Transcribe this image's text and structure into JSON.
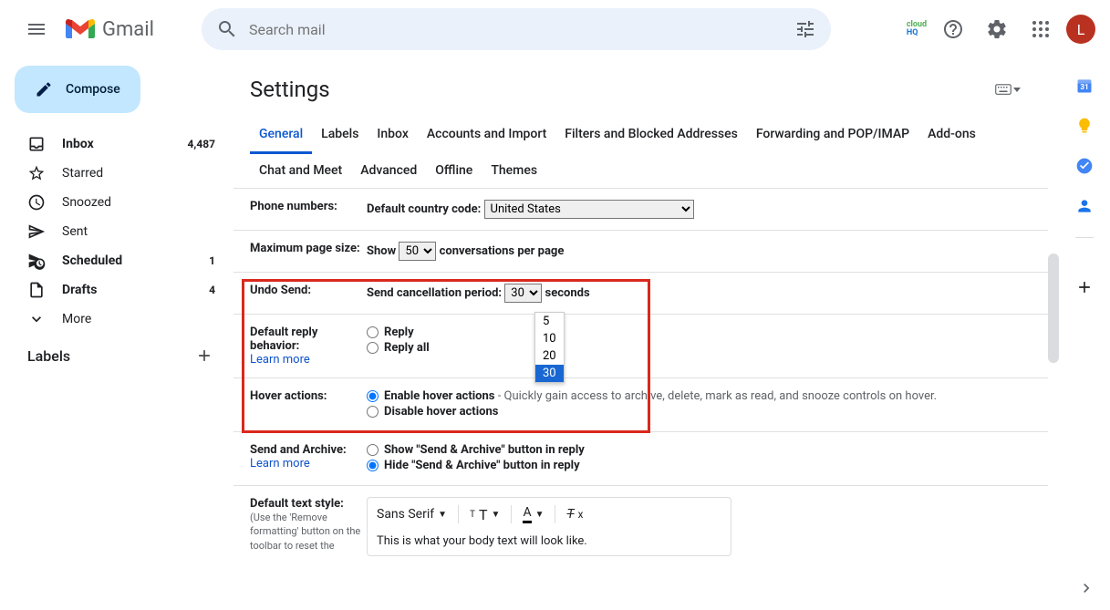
{
  "header": {
    "app_name": "Gmail",
    "search_placeholder": "Search mail",
    "avatar_letter": "L",
    "cloudhq_top": "cloud",
    "cloudhq_bottom": "HQ"
  },
  "sidebar": {
    "compose": "Compose",
    "items": [
      {
        "label": "Inbox",
        "count": "4,487",
        "bold": true
      },
      {
        "label": "Starred",
        "count": "",
        "bold": false
      },
      {
        "label": "Snoozed",
        "count": "",
        "bold": false
      },
      {
        "label": "Sent",
        "count": "",
        "bold": false
      },
      {
        "label": "Scheduled",
        "count": "1",
        "bold": true
      },
      {
        "label": "Drafts",
        "count": "4",
        "bold": true
      },
      {
        "label": "More",
        "count": "",
        "bold": false
      }
    ],
    "labels_header": "Labels"
  },
  "settings": {
    "title": "Settings",
    "tabs": [
      "General",
      "Labels",
      "Inbox",
      "Accounts and Import",
      "Filters and Blocked Addresses",
      "Forwarding and POP/IMAP",
      "Add-ons",
      "Chat and Meet",
      "Advanced",
      "Offline",
      "Themes"
    ],
    "active_tab": 0,
    "phone": {
      "label": "Phone numbers:",
      "desc": "Default country code:",
      "value": "United States"
    },
    "page_size": {
      "label": "Maximum page size:",
      "prefix": "Show",
      "value": "50",
      "suffix": "conversations per page"
    },
    "undo": {
      "label": "Undo Send:",
      "desc": "Send cancellation period:",
      "value": "30",
      "suffix": "seconds",
      "options": [
        "5",
        "10",
        "20",
        "30"
      ]
    },
    "reply": {
      "label": "Default reply behavior:",
      "learn": "Learn more",
      "opt1": "Reply",
      "opt2": "Reply all"
    },
    "hover": {
      "label": "Hover actions:",
      "opt1": "Enable hover actions",
      "opt1_desc": " - Quickly gain access to archive, delete, mark as read, and snooze controls on hover.",
      "opt2": "Disable hover actions"
    },
    "archive": {
      "label": "Send and Archive:",
      "learn": "Learn more",
      "opt1": "Show \"Send & Archive\" button in reply",
      "opt2": "Hide \"Send & Archive\" button in reply"
    },
    "textstyle": {
      "label": "Default text style:",
      "sub": "(Use the 'Remove formatting' button on the toolbar to reset the",
      "font": "Sans Serif",
      "sample": "This is what your body text will look like."
    }
  }
}
